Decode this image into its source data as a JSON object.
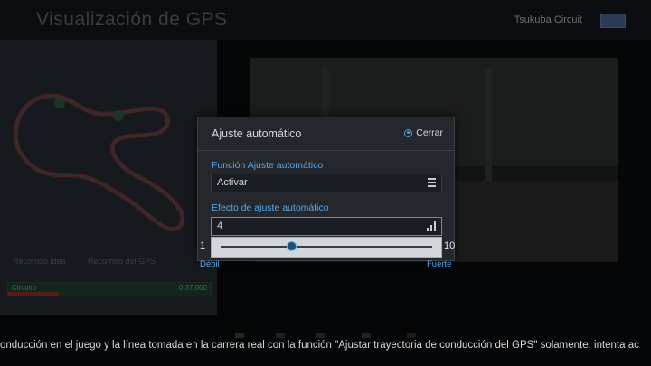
{
  "header": {
    "title": "Visualización de GPS",
    "circuit": "Tsukuba Circuit"
  },
  "left_panel": {
    "legend": [
      "Recorrido idea",
      "Recorrido del GPS"
    ],
    "bar_label": "Circuito",
    "bar_time": "0:37.000"
  },
  "dialog": {
    "title": "Ajuste automático",
    "close_label": "Cerrar",
    "field1": {
      "label": "Función Ajuste automático",
      "value": "Activar"
    },
    "field2": {
      "label": "Efecto de ajuste automático",
      "value": "4"
    },
    "slider": {
      "min": "1",
      "max": "10",
      "value": 4,
      "min_label": "Débil",
      "max_label": "Fuerte"
    }
  },
  "footer": {
    "help_text": "onducción en el juego y la línea tomada en la carrera real con la función \"Ajustar trayectoria de conducción del GPS\" solamente, intenta ac"
  },
  "colors": {
    "accent": "#5aa9ec",
    "dialog_bg": "#24272c"
  }
}
